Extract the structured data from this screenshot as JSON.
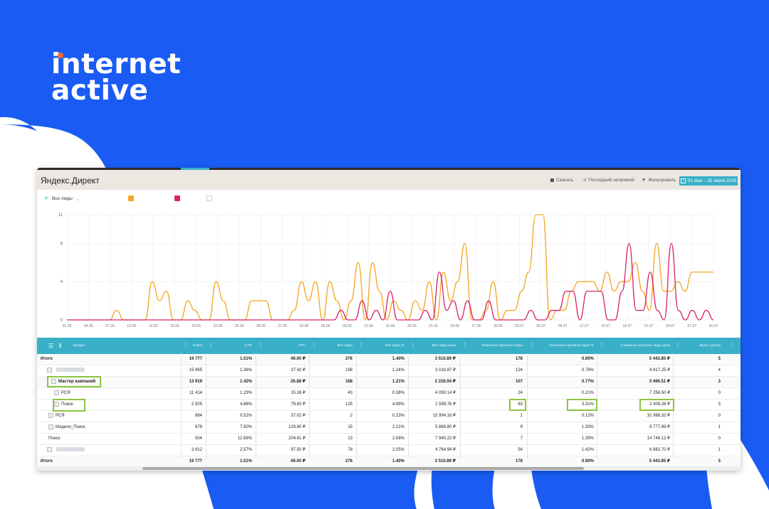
{
  "brand": {
    "line1": "internet",
    "line2": "active",
    "dot_color": "#ff6a2c"
  },
  "app": {
    "title": "Яндекс.Директ",
    "actions": {
      "download": "Скачать",
      "last_nonbrand": "Последний непрямой",
      "filter": "Фильтровать"
    },
    "date_range": "01 мая – 31 июля 2025"
  },
  "chart_legend": {
    "metric": "Все лиды"
  },
  "colors": {
    "accent": "#3ab0c8",
    "orange": "#f5a623",
    "pink": "#d6246e",
    "green_box": "#8cc63f"
  },
  "chart_data": {
    "type": "line",
    "ylim": [
      0,
      11
    ],
    "y_ticks": [
      "0",
      "4",
      "8",
      "11"
    ],
    "x_ticks": [
      "01.05",
      "04.05",
      "07.05",
      "10.05",
      "13.05",
      "16.05",
      "19.05",
      "22.05",
      "25.05",
      "28.05",
      "31.05",
      "03.06",
      "06.06",
      "09.06",
      "12.06",
      "15.06",
      "18.06",
      "21.06",
      "24.06",
      "27.06",
      "30.06",
      "03.07",
      "06.07",
      "09.07",
      "12.07",
      "15.07",
      "18.07",
      "21.07",
      "24.07",
      "27.07",
      "30.07"
    ],
    "series": [
      {
        "color": "#f5a623",
        "values": [
          0,
          0,
          0,
          0,
          0,
          0,
          0,
          1,
          0,
          0,
          0,
          0,
          4,
          2,
          3,
          0,
          0,
          2,
          1,
          0,
          0,
          4,
          2,
          0,
          0,
          0,
          2,
          2,
          2,
          0,
          0,
          0,
          1,
          4,
          2,
          4,
          0,
          4,
          2,
          0,
          2,
          6,
          0,
          6,
          3,
          0,
          2,
          1,
          0,
          2,
          1,
          4,
          0,
          5,
          2,
          4,
          8,
          0,
          0,
          1,
          4,
          0,
          1,
          1,
          3,
          5,
          11,
          11,
          0,
          1,
          1,
          3,
          4,
          4,
          4,
          3,
          5,
          3,
          4,
          4,
          6,
          3,
          1,
          8,
          3,
          3,
          4,
          3,
          5,
          5,
          5,
          5
        ]
      },
      {
        "color": "#d6246e",
        "values": [
          0,
          0,
          0,
          0,
          0,
          0,
          0,
          0,
          0,
          0,
          0,
          0,
          0,
          0,
          0,
          0,
          0,
          0,
          0,
          0,
          0,
          0,
          0,
          0,
          0,
          0,
          0,
          0,
          0,
          0,
          0,
          0,
          0,
          0,
          0,
          0,
          0,
          0,
          0,
          1,
          0,
          0,
          2,
          0,
          1,
          0,
          3,
          0,
          0,
          0,
          0,
          1,
          0,
          5,
          1,
          2,
          0,
          2,
          0,
          0,
          2,
          0,
          0,
          0,
          0,
          0,
          1,
          0,
          0,
          1,
          1,
          3,
          3,
          0,
          3,
          3,
          3,
          0,
          0,
          3,
          8,
          1,
          1,
          5,
          1,
          0,
          8,
          1,
          0,
          1,
          0,
          1,
          0
        ]
      }
    ]
  },
  "table": {
    "headers": [
      "Аккаунт",
      "Клики",
      "CTR",
      "CPC",
      "Все лиды",
      "Все лиды %",
      "Все лиды цена",
      "Уникально-целевые лиды",
      "Уникально-целевые лиды %",
      "Уникально-целевые лиды цена",
      "Всего сделок"
    ],
    "rows": [
      {
        "name": "Итого",
        "cells": [
          "19 777",
          "1.51%",
          "49.00 ₽",
          "276",
          "1.40%",
          "3 510.89 ₽",
          "178",
          "0.90%",
          "5 443.85 ₽",
          "5"
        ]
      },
      {
        "name": "",
        "cells": [
          "15 965",
          "1.38%",
          "37.42 ₽",
          "198",
          "1.24%",
          "3 016.87 ₽",
          "124",
          "0.78%",
          "4 817.25 ₽",
          "4"
        ]
      },
      {
        "name": "Мастер кампаний",
        "cells": [
          "13 919",
          "1.42%",
          "26.88 ₽",
          "168",
          "1.21%",
          "2 226.94 ₽",
          "107",
          "0.77%",
          "3 496.51 ₽",
          "3"
        ]
      },
      {
        "name": "РСЯ",
        "cells": [
          "11 414",
          "1.23%",
          "15.26 ₽",
          "43",
          "0.38%",
          "4 050.14 ₽",
          "24",
          "0.21%",
          "7 256.50 ₽",
          "0"
        ]
      },
      {
        "name": "Поиск",
        "cells": [
          "2 505",
          "4.86%",
          "79.83 ₽",
          "125",
          "4.99%",
          "1 599.76 ₽",
          "83",
          "3.31%",
          "2 409.28 ₽",
          "3"
        ]
      },
      {
        "name": "РСЯ",
        "cells": [
          "864",
          "0.52%",
          "37.02 ₽",
          "2",
          "0.23%",
          "15 994.16 ₽",
          "1",
          "0.12%",
          "31 988.32 ₽",
          "0"
        ]
      },
      {
        "name": "Модели_Поиск",
        "cells": [
          "678",
          "7.50%",
          "129.80 ₽",
          "15",
          "2.21%",
          "5 866.80 ₽",
          "9",
          "1.33%",
          "9 777.99 ₽",
          "1"
        ]
      },
      {
        "name": "Поиск",
        "cells": [
          "504",
          "12.89%",
          "204.81 ₽",
          "13",
          "2.58%",
          "7 940.22 ₽",
          "7",
          "1.39%",
          "14 746.12 ₽",
          "0"
        ]
      },
      {
        "name": "",
        "cells": [
          "3 812",
          "2.57%",
          "97.50 ₽",
          "78",
          "2.05%",
          "4 764.94 ₽",
          "54",
          "1.42%",
          "6 882.70 ₽",
          "1"
        ]
      },
      {
        "name": "Итого",
        "cells": [
          "19 777",
          "1.51%",
          "49.00 ₽",
          "276",
          "1.40%",
          "3 510.89 ₽",
          "178",
          "0.90%",
          "5 443.85 ₽",
          "5"
        ]
      }
    ]
  }
}
